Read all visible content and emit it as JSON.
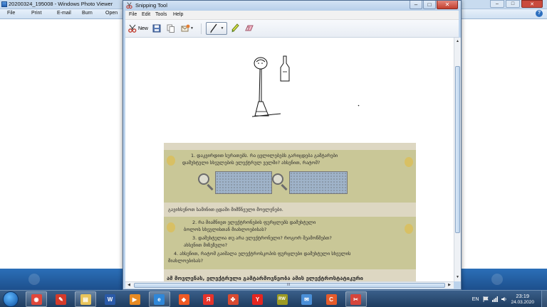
{
  "photo_viewer": {
    "title": "20200324_195008 - Windows Photo Viewer",
    "menu": [
      "File",
      "Print",
      "E-mail",
      "Burn",
      "Open"
    ],
    "help_label": "?"
  },
  "snipping_tool": {
    "title": "Snipping Tool",
    "caption_buttons": {
      "minimize": "–",
      "maximize": "□",
      "close": "✕"
    },
    "menu": [
      "File",
      "Edit",
      "Tools",
      "Help"
    ],
    "toolbar": {
      "new_label": "New",
      "new_icon": "scissors-new-icon",
      "save_icon": "save-icon",
      "copy_icon": "copy-icon",
      "send_icon": "send-email-icon",
      "pen_icon": "pen-icon",
      "highlighter_icon": "highlighter-icon",
      "eraser_icon": "eraser-icon",
      "dropdown_glyph": "▼"
    },
    "scrollbar": {
      "grip": "III",
      "up": "▲",
      "down": "▼",
      "left": "◀",
      "right": "▶"
    }
  },
  "photo": {
    "q1": "1. დაკვირდით სურათებს. რა ცვლილებებს გარიცდება გამტარები",
    "q1b": "დამუხტული სხეულების ელექტრულ ველში? ახსენით, რატომ?",
    "intro": "გავიხსენოთ სამინით ცდაში მიმწნეული მოვლენები.",
    "q2": "2. რა მიამნიეთ ელექტრონების ფურცლებს დამუხტული",
    "q2b": "ბოლოს სხეულისთან მიახლოებისას?",
    "q3": "3. დამუხტულია თუ არა ელექტრონული? როგორ შეამოწმებთ?",
    "q3b": "ახსენით მიზეზული?",
    "q4": "4. ახსენით, რატომ გაიშალა ელექტროსკოპის ფურცლები დამუხტული სხეულის",
    "q4b": "მიახლოებისას?",
    "bottom": "ამ მოვლენას, ელექტრული გამტარმოვნეობა ამის ელექტროსტატიკური"
  },
  "taskbar": {
    "apps": [
      {
        "name": "chrome",
        "glyph": "◉",
        "color": "#e0473a"
      },
      {
        "name": "paint-tool",
        "glyph": "✎",
        "color": "#d43a2a"
      },
      {
        "name": "file-explorer",
        "glyph": "▤",
        "color": "#e9c45b"
      },
      {
        "name": "word",
        "glyph": "W",
        "color": "#2a5aa8"
      },
      {
        "name": "media-player",
        "glyph": "▶",
        "color": "#e68a23"
      },
      {
        "name": "internet-explorer",
        "glyph": "e",
        "color": "#2f87d8"
      },
      {
        "name": "brave",
        "glyph": "◆",
        "color": "#f05a24"
      },
      {
        "name": "yandex-browser",
        "glyph": "Я",
        "color": "#e6332a"
      },
      {
        "name": "puzzle-app",
        "glyph": "✤",
        "color": "#d84a31"
      },
      {
        "name": "yandex",
        "glyph": "Y",
        "color": "#e52520"
      },
      {
        "name": "rw-app",
        "glyph": "RW",
        "color": "#9c9a22"
      },
      {
        "name": "mail-app",
        "glyph": "✉",
        "color": "#4a8fd8"
      },
      {
        "name": "c-app",
        "glyph": "C",
        "color": "#e55b2b"
      },
      {
        "name": "snipping-tool",
        "glyph": "✂",
        "color": "#d6453b"
      }
    ],
    "language": "EN",
    "time": "23:19",
    "date": "24.03.2020"
  }
}
